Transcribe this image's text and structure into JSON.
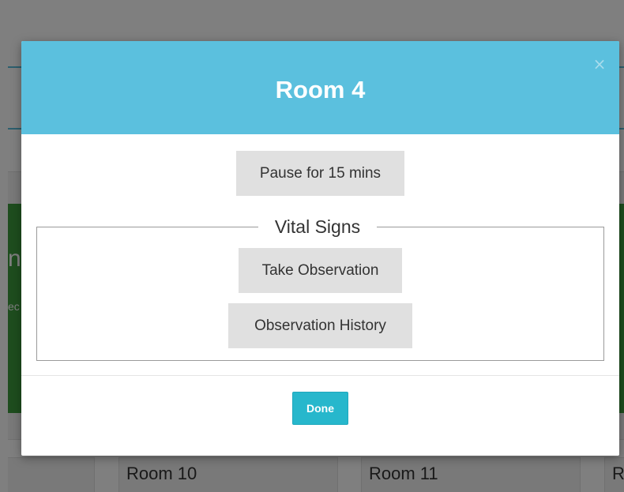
{
  "modal": {
    "title": "Room 4",
    "close_label": "×",
    "pause_button": "Pause for 15 mins",
    "vital_signs": {
      "legend": "Vital Signs",
      "take_observation": "Take Observation",
      "observation_history": "Observation History"
    },
    "done_button": "Done"
  },
  "background": {
    "rooms": [
      "Room 10",
      "Room 11",
      "R"
    ],
    "edge_fragments": [
      "n",
      "ec"
    ]
  },
  "colors": {
    "header": "#5bc0de",
    "done": "#27b7cc",
    "status_green": "#3d9a3d"
  }
}
